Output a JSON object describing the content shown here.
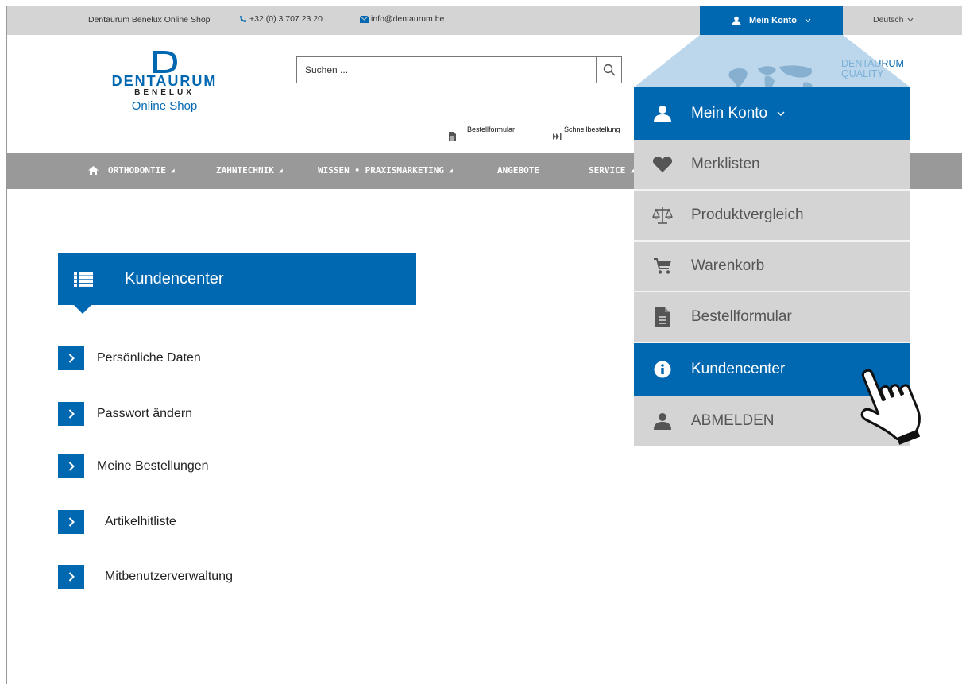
{
  "topbar": {
    "shop_name": "Dentaurum Benelux Online Shop",
    "phone": "+32 (0) 3 707 23 20",
    "email": "info@dentaurum.be",
    "account_label": "Mein Konto",
    "language": "Deutsch"
  },
  "header": {
    "logo_letter": "D",
    "logo_word": "DENTAURUM",
    "logo_sub": "BENELUX",
    "logo_shop": "Online Shop",
    "search_placeholder": "Suchen ...",
    "quality_line1": "DENTAURUM",
    "quality_line2": "QUALITY",
    "link_order_form": "Bestellformular",
    "link_quick_order": "Schnellbestellung"
  },
  "nav": {
    "items": [
      "ORTHODONTIE",
      "ZAHNTECHNIK",
      "WISSEN • PRAXISMARKETING",
      "ANGEBOTE",
      "SERVICE"
    ]
  },
  "kundencenter": {
    "title": "Kundencenter",
    "links": [
      "Persönliche Daten",
      "Passwort ändern",
      "Meine Bestellungen",
      "Artikelhitliste",
      "Mitbenutzerverwaltung"
    ]
  },
  "dropdown": {
    "items": [
      {
        "label": "Mein Konto",
        "icon": "user-icon"
      },
      {
        "label": "Merklisten",
        "icon": "heart-icon"
      },
      {
        "label": "Produktvergleich",
        "icon": "scale-icon"
      },
      {
        "label": "Warenkorb",
        "icon": "cart-icon"
      },
      {
        "label": "Bestellformular",
        "icon": "document-icon"
      },
      {
        "label": "Kundencenter",
        "icon": "info-icon"
      },
      {
        "label": "ABMELDEN",
        "icon": "user-icon"
      }
    ]
  },
  "colors": {
    "brand_blue": "#0067b1",
    "topbar_gray": "#d4d4d4",
    "nav_gray": "#999999"
  }
}
